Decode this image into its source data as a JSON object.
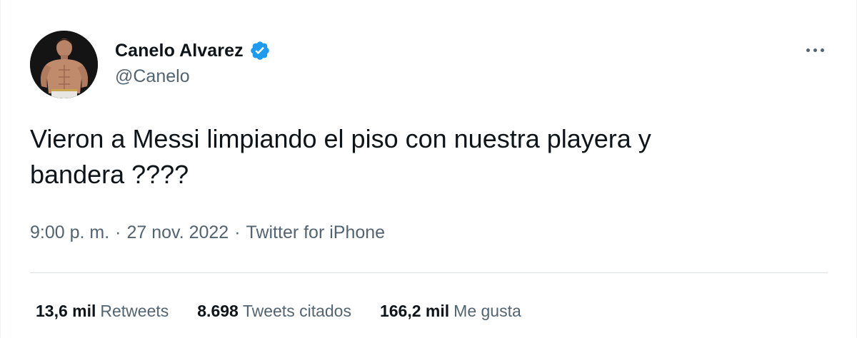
{
  "author": {
    "display_name": "Canelo Alvarez",
    "handle": "@Canelo",
    "verified": true,
    "avatar_icon": "profile-photo-shirtless-boxer"
  },
  "tweet": {
    "text": "Vieron a Messi limpiando el piso con nuestra playera y\nbandera ????",
    "time": "9:00 p. m.",
    "date": "27 nov. 2022",
    "source": "Twitter for iPhone",
    "separator": "·"
  },
  "stats": {
    "retweets": {
      "count": "13,6 mil",
      "label": "Retweets"
    },
    "quotes": {
      "count": "8.698",
      "label": "Tweets citados"
    },
    "likes": {
      "count": "166,2 mil",
      "label": "Me gusta"
    }
  },
  "colors": {
    "verified_blue": "#1d9bf0",
    "text_primary": "#0f1419",
    "text_secondary": "#536471",
    "divider": "#dbe1e4"
  },
  "icons": {
    "more": "more-horizontal-icon",
    "verified": "verified-badge-icon"
  }
}
